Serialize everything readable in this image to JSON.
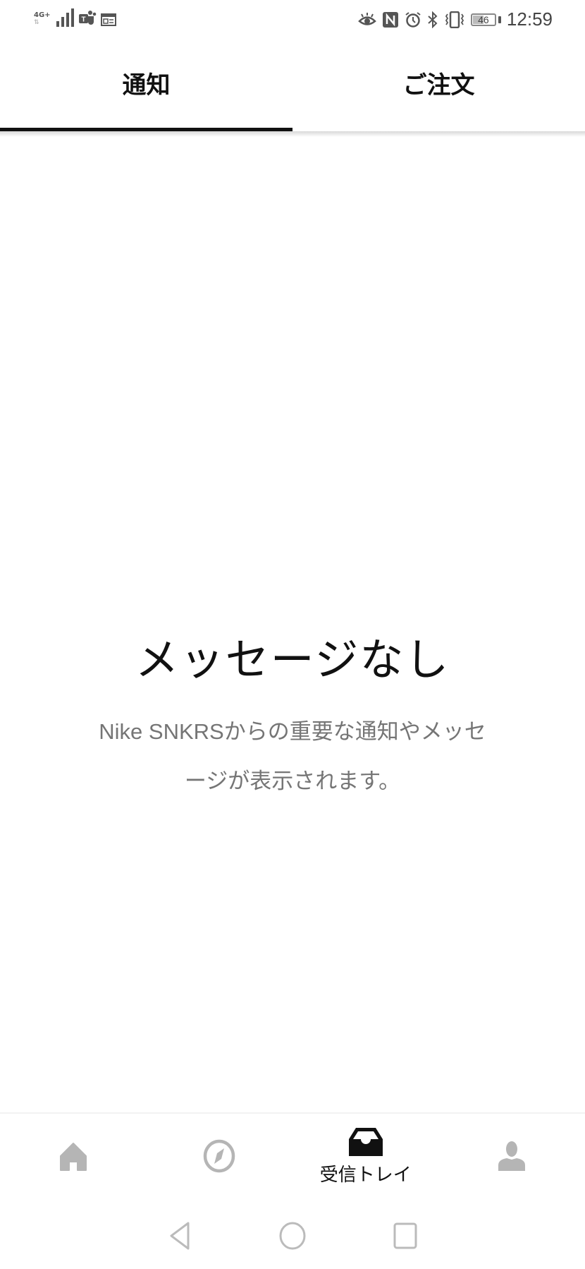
{
  "status_bar": {
    "network_type": "4G+",
    "data_arrows": "⇅",
    "signal_bars": 4,
    "notification_icons": [
      "teams-icon",
      "news-icon"
    ],
    "system_icons": [
      "eye-comfort-icon",
      "nfc-icon",
      "alarm-icon",
      "bluetooth-icon",
      "vibrate-icon"
    ],
    "battery_level": "46",
    "time": "12:59"
  },
  "tabs": [
    {
      "label": "通知",
      "active": true
    },
    {
      "label": "ご注文",
      "active": false
    }
  ],
  "empty_state": {
    "title": "メッセージなし",
    "description": "Nike SNKRSからの重要な通知やメッセージが表示されます。"
  },
  "bottom_nav": {
    "items": [
      {
        "name": "home",
        "icon": "home-icon",
        "label": "",
        "active": false
      },
      {
        "name": "discover",
        "icon": "compass-icon",
        "label": "",
        "active": false
      },
      {
        "name": "inbox",
        "icon": "inbox-icon",
        "label": "受信トレイ",
        "active": true
      },
      {
        "name": "profile",
        "icon": "profile-icon",
        "label": "",
        "active": false
      }
    ]
  },
  "colors": {
    "active": "#111111",
    "inactive_icon": "#b5b5b5",
    "description_text": "#757575"
  }
}
